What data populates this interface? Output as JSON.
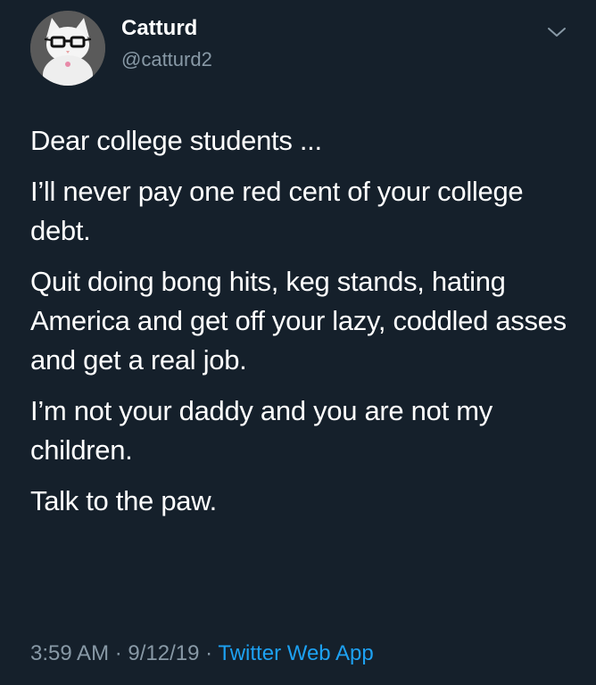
{
  "tweet": {
    "author": {
      "name": "Catturd",
      "handle": "@catturd2",
      "avatar_icon": "cat-with-glasses-avatar"
    },
    "menu_icon": "chevron-down-icon",
    "paragraphs": [
      "Dear college students ...",
      "I’ll never pay one red cent of your college debt.",
      "Quit doing bong hits, keg stands, hating America and get off your lazy, coddled asses and get a real job.",
      "I’m not your daddy and you are not my children.",
      "Talk to the paw."
    ],
    "time": "3:59 AM",
    "separator": "·",
    "date": "9/12/19",
    "source": "Twitter Web App"
  },
  "colors": {
    "background": "#15202b",
    "text": "#ffffff",
    "muted": "#8899a6",
    "link": "#1da1f2"
  }
}
